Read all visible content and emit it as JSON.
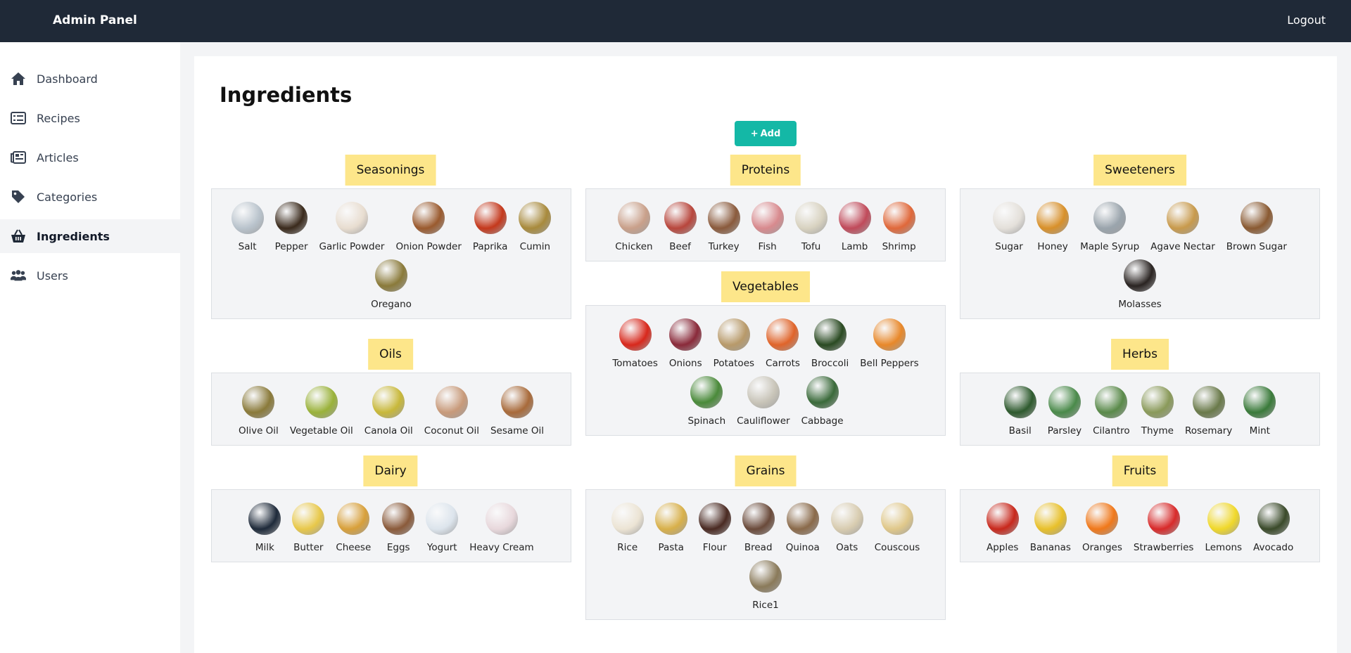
{
  "header": {
    "title": "Admin Panel",
    "logout_label": "Logout"
  },
  "sidebar": {
    "items": [
      {
        "label": "Dashboard",
        "icon": "home-icon"
      },
      {
        "label": "Recipes",
        "icon": "list-icon"
      },
      {
        "label": "Articles",
        "icon": "newspaper-icon"
      },
      {
        "label": "Categories",
        "icon": "tag-icon"
      },
      {
        "label": "Ingredients",
        "icon": "basket-icon",
        "active": true
      },
      {
        "label": "Users",
        "icon": "users-icon"
      }
    ]
  },
  "main": {
    "title": "Ingredients",
    "add_label": "Add",
    "categories": [
      {
        "name": "Seasonings",
        "items": [
          {
            "name": "Salt",
            "color": "#b9c3cc"
          },
          {
            "name": "Pepper",
            "color": "#3a2a1c"
          },
          {
            "name": "Garlic Powder",
            "color": "#e8ddd0"
          },
          {
            "name": "Onion Powder",
            "color": "#9a5a2e"
          },
          {
            "name": "Paprika",
            "color": "#c4381c"
          },
          {
            "name": "Cumin",
            "color": "#a88a3c"
          },
          {
            "name": "Oregano",
            "color": "#8a7a3a"
          }
        ]
      },
      {
        "name": "Proteins",
        "items": [
          {
            "name": "Chicken",
            "color": "#c9a08a"
          },
          {
            "name": "Beef",
            "color": "#b8463c"
          },
          {
            "name": "Turkey",
            "color": "#8a5a3c"
          },
          {
            "name": "Fish",
            "color": "#d88a8e"
          },
          {
            "name": "Tofu",
            "color": "#d8d2c0"
          },
          {
            "name": "Lamb",
            "color": "#c04a5a"
          },
          {
            "name": "Shrimp",
            "color": "#e0683a"
          }
        ]
      },
      {
        "name": "Sweeteners",
        "items": [
          {
            "name": "Sugar",
            "color": "#e4e0da"
          },
          {
            "name": "Honey",
            "color": "#d8902a"
          },
          {
            "name": "Maple Syrup",
            "color": "#9aa4ac"
          },
          {
            "name": "Agave Nectar",
            "color": "#c89a4c"
          },
          {
            "name": "Brown Sugar",
            "color": "#8a5a32"
          },
          {
            "name": "Molasses",
            "color": "#2a2422"
          }
        ]
      },
      {
        "name": "Vegetables",
        "items": [
          {
            "name": "Tomatoes",
            "color": "#d8281c"
          },
          {
            "name": "Onions",
            "color": "#8a2a3a"
          },
          {
            "name": "Potatoes",
            "color": "#b89a6a"
          },
          {
            "name": "Carrots",
            "color": "#e0642a"
          },
          {
            "name": "Broccoli",
            "color": "#2a4a22"
          },
          {
            "name": "Bell Peppers",
            "color": "#e8882a"
          },
          {
            "name": "Spinach",
            "color": "#4a8a3a"
          },
          {
            "name": "Cauliflower",
            "color": "#c8c4b8"
          },
          {
            "name": "Cabbage",
            "color": "#3a6a3a"
          }
        ]
      },
      {
        "name": "Oils",
        "items": [
          {
            "name": "Olive Oil",
            "color": "#8a7a3a"
          },
          {
            "name": "Vegetable Oil",
            "color": "#9ab23a"
          },
          {
            "name": "Canola Oil",
            "color": "#c8b83a"
          },
          {
            "name": "Coconut Oil",
            "color": "#c89a7a"
          },
          {
            "name": "Sesame Oil",
            "color": "#a86a3a"
          }
        ]
      },
      {
        "name": "Herbs",
        "items": [
          {
            "name": "Basil",
            "color": "#2e5a2e"
          },
          {
            "name": "Parsley",
            "color": "#4a8a4a"
          },
          {
            "name": "Cilantro",
            "color": "#5a8a4a"
          },
          {
            "name": "Thyme",
            "color": "#8a9a5a"
          },
          {
            "name": "Rosemary",
            "color": "#6a7a4a"
          },
          {
            "name": "Mint",
            "color": "#3a7a3a"
          }
        ]
      },
      {
        "name": "Dairy",
        "items": [
          {
            "name": "Milk",
            "color": "#1e2a3a"
          },
          {
            "name": "Butter",
            "color": "#e8c84a"
          },
          {
            "name": "Cheese",
            "color": "#d8a03a"
          },
          {
            "name": "Eggs",
            "color": "#8a5a3a"
          },
          {
            "name": "Yogurt",
            "color": "#dce4ec"
          },
          {
            "name": "Heavy Cream",
            "color": "#e8d8dc"
          }
        ]
      },
      {
        "name": "Grains",
        "items": [
          {
            "name": "Rice",
            "color": "#ece4d4"
          },
          {
            "name": "Pasta",
            "color": "#d8b04a"
          },
          {
            "name": "Flour",
            "color": "#4a2a22"
          },
          {
            "name": "Bread",
            "color": "#6a4a3a"
          },
          {
            "name": "Quinoa",
            "color": "#8a6a4a"
          },
          {
            "name": "Oats",
            "color": "#d8ccb0"
          },
          {
            "name": "Couscous",
            "color": "#e0c88a"
          },
          {
            "name": "Rice1",
            "color": "#8a7a5a"
          }
        ]
      },
      {
        "name": "Fruits",
        "items": [
          {
            "name": "Apples",
            "color": "#c8281c"
          },
          {
            "name": "Bananas",
            "color": "#e8c02a"
          },
          {
            "name": "Oranges",
            "color": "#f0781a"
          },
          {
            "name": "Strawberries",
            "color": "#d82a2a"
          },
          {
            "name": "Lemons",
            "color": "#f0d82a"
          },
          {
            "name": "Avocado",
            "color": "#3a4a2a"
          }
        ]
      }
    ]
  }
}
